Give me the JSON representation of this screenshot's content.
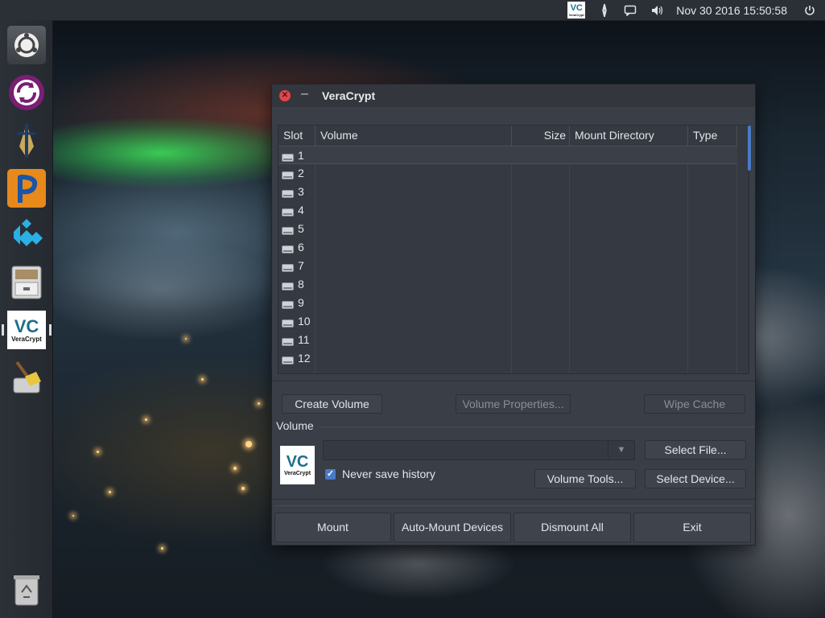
{
  "top_panel": {
    "tray_icons": [
      "veracrypt-tray-icon",
      "bluetooth-icon",
      "chat-icon",
      "volume-icon",
      "power-icon"
    ],
    "veracrypt_tray": {
      "mark": "VC",
      "text": "VeraCrypt"
    },
    "clock": "Nov 30 2016 15:50:58"
  },
  "launcher": {
    "items": [
      "ubuntu-logo-icon",
      "sync-app-icon",
      "pen-app-icon",
      "p-app-icon",
      "kodi-icon",
      "file-cabinet-icon",
      "veracrypt-icon",
      "broom-cleaner-icon"
    ],
    "veracrypt_label": {
      "mark": "VC",
      "text": "VeraCrypt"
    },
    "trash": "trash-icon"
  },
  "window": {
    "title": "VeraCrypt",
    "close_glyph": "✕",
    "minimize_glyph": "–",
    "table": {
      "columns": [
        "Slot",
        "Volume",
        "Size",
        "Mount Directory",
        "Type"
      ],
      "rows": [
        "1",
        "2",
        "3",
        "4",
        "5",
        "6",
        "7",
        "8",
        "9",
        "10",
        "11",
        "12"
      ],
      "selected_row": "1"
    },
    "buttons": {
      "create_volume": "Create Volume",
      "volume_properties": "Volume Properties...",
      "wipe_cache": "Wipe Cache"
    },
    "volume_group": {
      "label": "Volume",
      "logo": {
        "mark": "VC",
        "text": "VeraCrypt"
      },
      "path_value": "",
      "never_save_history": {
        "label": "Never save history",
        "checked": true
      },
      "select_file": "Select File...",
      "volume_tools": "Volume Tools...",
      "select_device": "Select Device..."
    },
    "bottom_buttons": {
      "mount": "Mount",
      "auto_mount": "Auto-Mount Devices",
      "dismount_all": "Dismount All",
      "exit": "Exit"
    }
  },
  "colors": {
    "accent": "#4a79c8",
    "window_bg": "#3a3e47",
    "panel_bg": "#2b2f36",
    "close_red": "#e0464b"
  }
}
